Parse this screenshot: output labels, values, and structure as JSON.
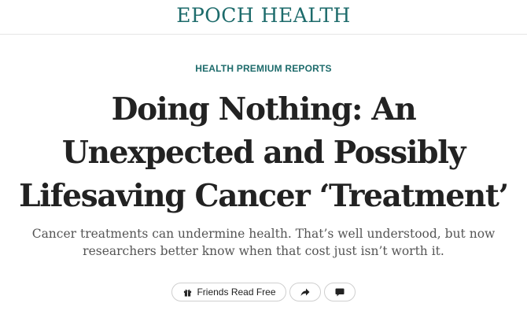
{
  "header": {
    "logo": "EPOCH HEALTH",
    "brand_color": "#1d6b6b"
  },
  "article": {
    "kicker": "HEALTH PREMIUM REPORTS",
    "headline": "Doing Nothing: An Unexpected and Possibly Lifesaving Cancer ‘Treatment’",
    "subhead": "Cancer treatments can undermine health. That’s well understood, but now researchers better know when that cost just isn’t worth it."
  },
  "actions": {
    "friends_label": "Friends Read Free",
    "friends_icon": "gift-icon",
    "share_icon": "share-arrow-icon",
    "comment_icon": "comment-icon"
  }
}
